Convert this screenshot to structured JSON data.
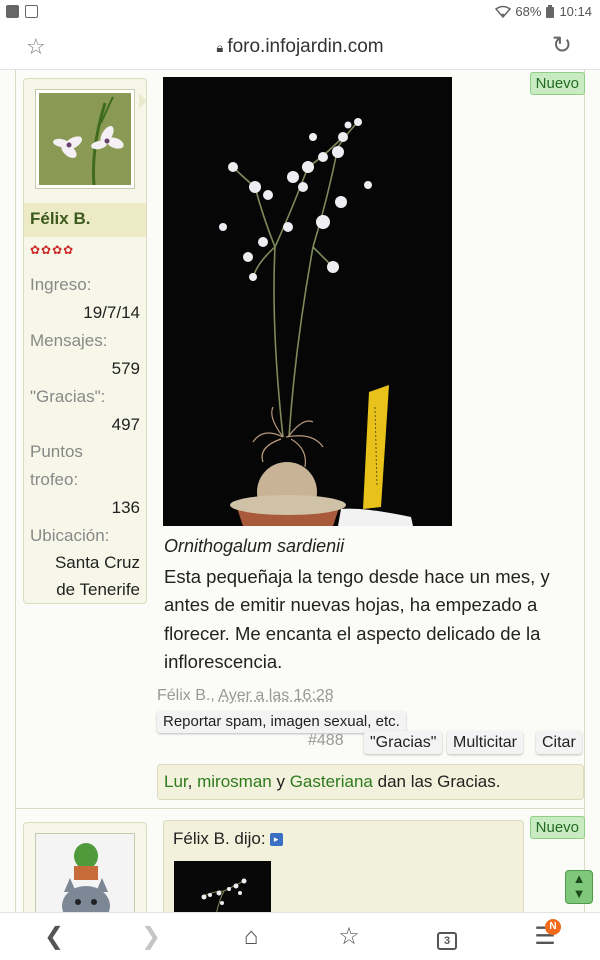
{
  "status": {
    "battery": "68%",
    "time": "10:14",
    "icons": [
      "notification-square-icon",
      "gallery-icon",
      "wifi-icon",
      "battery-icon"
    ]
  },
  "browser": {
    "url": "foro.infojardin.com",
    "icons": [
      "bookmark-star-icon",
      "lock-icon",
      "reload-icon"
    ]
  },
  "post": {
    "badge": "Nuevo",
    "user": {
      "name": "Félix B.",
      "flowers": "✿✿✿✿",
      "join_label": "Ingreso:",
      "join_value": "19/7/14",
      "messages_label": "Mensajes:",
      "messages_value": "579",
      "thanks_label": "\"Gracias\":",
      "thanks_value": "497",
      "points_label_1": "Puntos",
      "points_label_2": "trofeo:",
      "points_value": "136",
      "location_label": "Ubicación:",
      "location_value_1": "Santa Cruz",
      "location_value_2": "de Tenerife"
    },
    "caption": "Ornithogalum sardienii",
    "text": "Esta pequeñaja la tengo desde hace un mes, y antes de emitir nuevas hojas, ha empezado a florecer. Me encanta el aspecto delicado de la inflorescencia.",
    "meta_author": "Félix B.,",
    "meta_time": "Ayer a las 16:28",
    "report": "Reportar spam, imagen sexual, etc.",
    "number": "#488",
    "actions": {
      "thanks": "\"Gracias\"",
      "multiquote": "Multicitar",
      "quote": "Citar"
    },
    "thanks_bar": {
      "user1": "Lur",
      "sep1": ",",
      "user2": "mirosman",
      "sep2": "y",
      "user3": "Gasteriana",
      "suffix": "dan las Gracias."
    }
  },
  "post2": {
    "badge": "Nuevo",
    "quote_author": "Félix B. dijo:",
    "quote_arrow": "▸"
  },
  "nav": {
    "tabs_count": "3",
    "notification": "N",
    "icons": [
      "back-icon",
      "forward-icon",
      "home-icon",
      "bookmarks-icon",
      "tabs-icon",
      "menu-icon"
    ]
  },
  "colors": {
    "accent_green": "#2f7a1d",
    "badge_bg": "#c8ebc2",
    "username": "#3c5a1e",
    "notif": "#f26b1d"
  }
}
